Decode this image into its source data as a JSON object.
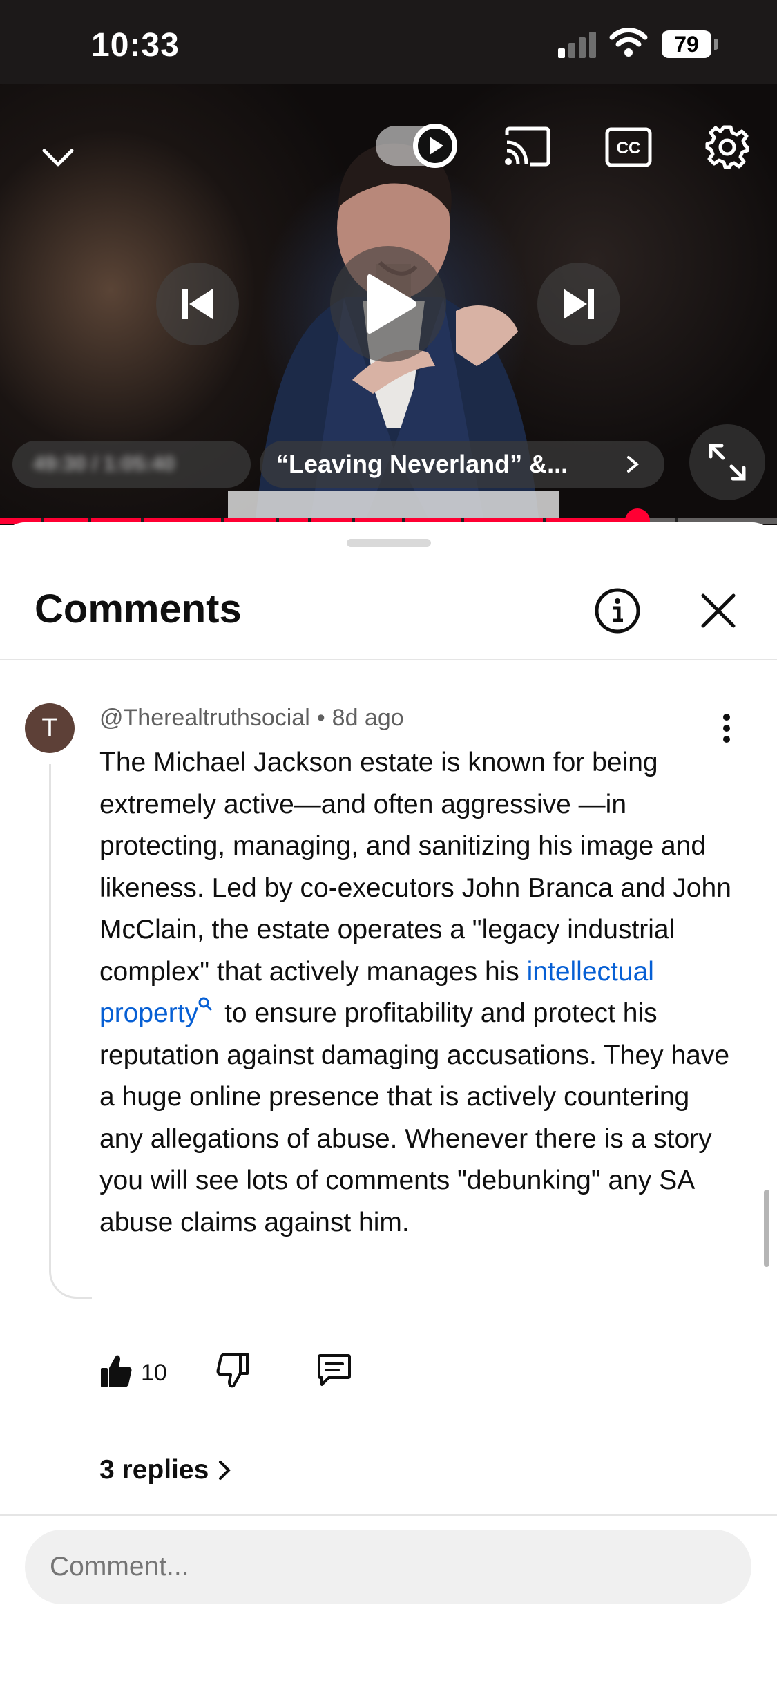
{
  "status_bar": {
    "time": "10:33",
    "battery": "79"
  },
  "player": {
    "chapter_title": "“Leaving Neverland” &...",
    "time_redacted": "49:30 / 1:05:40",
    "progress_fraction": 0.82,
    "icons": [
      "collapse-chevron-icon",
      "autoplay-toggle-icon",
      "cast-icon",
      "captions-icon",
      "settings-gear-icon",
      "previous-icon",
      "play-icon",
      "next-icon",
      "fullscreen-icon"
    ],
    "accent_color": "#ff0033"
  },
  "comments_sheet": {
    "title": "Comments",
    "comment": {
      "avatar_letter": "T",
      "author": "@Therealtruthsocial",
      "separator": "•",
      "age": "8d ago",
      "text_before_link": "The Michael Jackson estate is known for being extremely active—and often aggressive —in protecting, managing, and sanitizing his image and likeness. Led by co-executors John Branca and John McClain, the estate operates a \"legacy industrial complex\" that actively manages his ",
      "link_text": "intellectual property",
      "text_after_link": "to ensure profitability and protect his reputation against damaging accusations. They have a huge online presence that is actively countering any allegations of abuse. Whenever there is a story you will see lots of comments \"debunking\" any SA abuse claims against him.",
      "like_count": "10",
      "replies_label": "3 replies"
    },
    "input_placeholder": "Comment..."
  }
}
